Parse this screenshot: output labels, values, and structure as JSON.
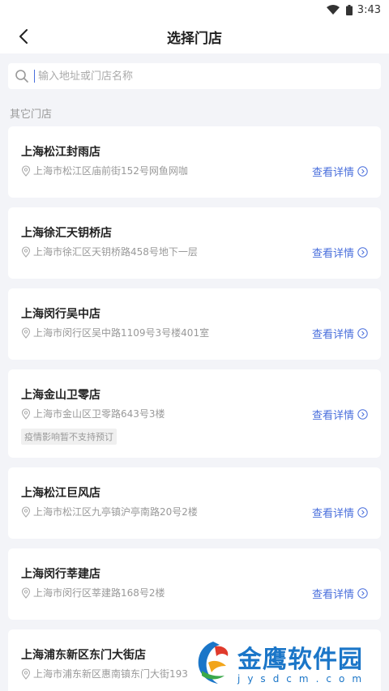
{
  "status_bar": {
    "time": "3:43"
  },
  "header": {
    "title": "选择门店"
  },
  "search": {
    "placeholder": "输入地址或门店名称"
  },
  "section": {
    "label": "其它门店"
  },
  "stores": [
    {
      "name": "上海松江封雨店",
      "address": "上海市松江区庙前街152号网鱼网咖",
      "detail_label": "查看详情"
    },
    {
      "name": "上海徐汇天钥桥店",
      "address": "上海市徐汇区天钥桥路458号地下一层",
      "detail_label": "查看详情"
    },
    {
      "name": "上海闵行吴中店",
      "address": "上海市闵行区吴中路1109号3号楼401室",
      "detail_label": "查看详情"
    },
    {
      "name": "上海金山卫零店",
      "address": "上海市金山区卫零路643号3楼",
      "detail_label": "查看详情",
      "tag": "疫情影响暂不支持预订"
    },
    {
      "name": "上海松江巨风店",
      "address": "上海市松江区九亭镇沪亭南路20号2楼",
      "detail_label": "查看详情"
    },
    {
      "name": "上海闵行莘建店",
      "address": "上海市闵行区莘建路168号2楼",
      "detail_label": "查看详情"
    },
    {
      "name": "上海浦东新区东门大街店",
      "address": "上海市浦东新区惠南镇东门大街193"
    }
  ],
  "watermark": {
    "name": "金鹰软件园",
    "domain": "jysdcm.com"
  },
  "colors": {
    "accent": "#4a6fdc",
    "background": "#f3f4f8",
    "card": "#ffffff"
  }
}
